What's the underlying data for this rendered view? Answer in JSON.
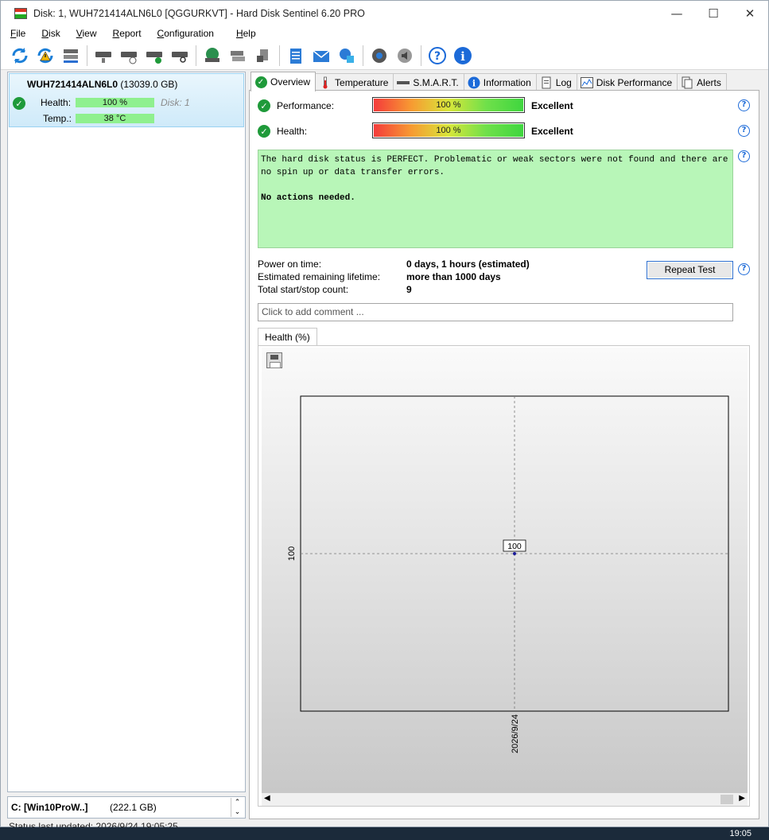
{
  "window": {
    "title": "Disk: 1, WUH721414ALN6L0 [QGGURKVT]  -  Hard Disk Sentinel 6.20 PRO",
    "controls": [
      "minimize-icon",
      "maximize-icon",
      "close-icon"
    ]
  },
  "menu": [
    "File",
    "Disk",
    "View",
    "Report",
    "Configuration",
    "Help"
  ],
  "toolbar": {
    "icons": [
      "refresh-icon",
      "refresh-warning-icon",
      "disk-list-icon",
      "disk-info-icon",
      "disk-schedule-icon",
      "disk-ok-icon",
      "disk-search-icon",
      "network-disk-icon",
      "disk-tools-icon",
      "disk-print-icon",
      "report-notepad-icon",
      "email-icon",
      "web-report-icon",
      "settings-icon",
      "sound-icon",
      "help-icon",
      "info-icon"
    ]
  },
  "disk": {
    "name": "WUH721414ALN6L0",
    "capacity": "(13039.0 GB)",
    "health_label": "Health:",
    "health_value": "100 %",
    "disk_number": "Disk: 1",
    "temp_label": "Temp.:",
    "temp_value": "38 °C"
  },
  "drive_selector": {
    "name": "C: [Win10ProW..]",
    "size": "(222.1 GB)"
  },
  "status_bar": "Status last updated: 2026/9/24 19:05:25",
  "tabs": [
    {
      "label": "Overview",
      "icon": "check-icon",
      "active": true
    },
    {
      "label": "Temperature",
      "icon": "thermometer-icon",
      "active": false
    },
    {
      "label": "S.M.A.R.T.",
      "icon": "smart-icon",
      "active": false
    },
    {
      "label": "Information",
      "icon": "info-icon",
      "active": false
    },
    {
      "label": "Log",
      "icon": "document-icon",
      "active": false
    },
    {
      "label": "Disk Performance",
      "icon": "performance-chart-icon",
      "active": false
    },
    {
      "label": "Alerts",
      "icon": "alerts-icon",
      "active": false
    }
  ],
  "overview": {
    "performance": {
      "label": "Performance:",
      "value": "100 %",
      "percent": 100,
      "rating": "Excellent"
    },
    "health": {
      "label": "Health:",
      "value": "100 %",
      "percent": 100,
      "rating": "Excellent"
    },
    "status_text": "The hard disk status is PERFECT. Problematic or weak sectors were not found and there are no spin up or data transfer errors.",
    "actions_text": "No actions needed.",
    "power_on_label": "Power on time:",
    "power_on_value": "0 days, 1 hours (estimated)",
    "remaining_label": "Estimated remaining lifetime:",
    "remaining_value": "more than 1000 days",
    "startstop_label": "Total start/stop count:",
    "startstop_value": "9",
    "repeat_button": "Repeat Test",
    "comment_placeholder": "Click to add comment ..."
  },
  "chart_tab": "Health (%)",
  "chart_data": {
    "type": "line",
    "x": [
      "2026/9/24"
    ],
    "series": [
      {
        "values": [
          100
        ]
      }
    ],
    "data_labels": [
      "100"
    ],
    "y_tick_labels": [
      "100"
    ],
    "x_tick_labels": [
      "2026/9/24"
    ],
    "grid": true
  },
  "taskbar": {
    "time": "19:05"
  }
}
